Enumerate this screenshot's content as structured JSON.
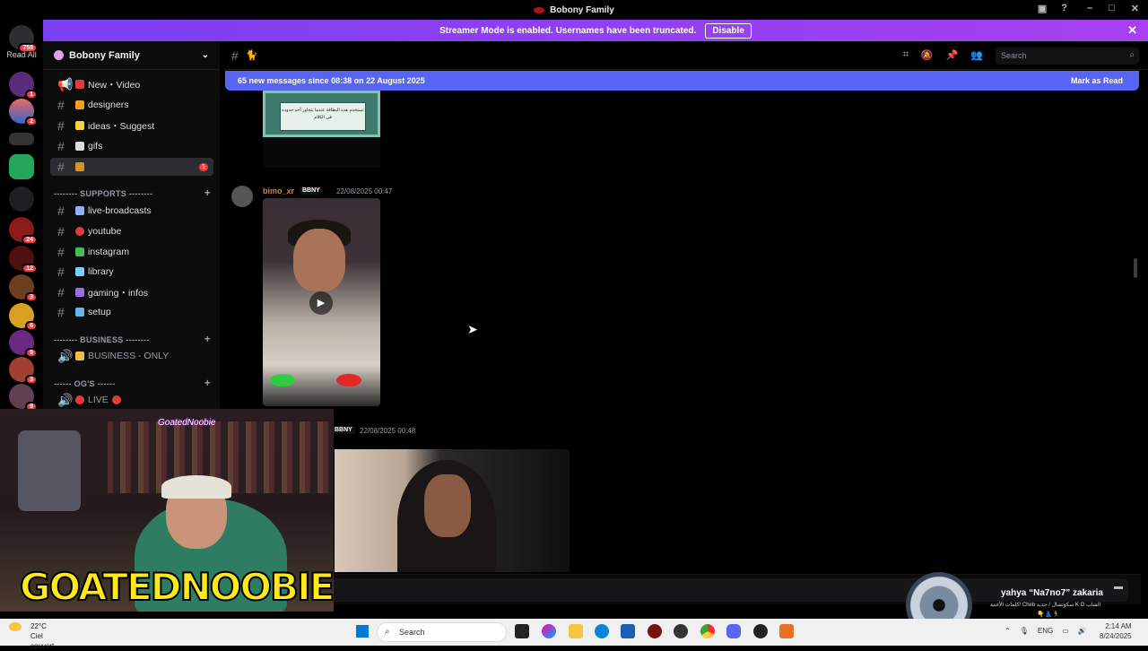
{
  "window": {
    "title": "Bobony Family"
  },
  "servers": {
    "read_all_label": "Read All",
    "top_badge": "758",
    "badges": [
      "1",
      "2",
      "24",
      "12",
      "3",
      "6",
      "9",
      "3",
      "9"
    ]
  },
  "streamer_banner": {
    "text": "Streamer Mode is enabled. Usernames have been truncated.",
    "disable_label": "Disable"
  },
  "guild": {
    "name": "Bobony Family"
  },
  "channels": [
    {
      "name": "New・Video",
      "prefix": "📢",
      "color": "#e23b3b"
    },
    {
      "name": "designers",
      "color": "#f0a020"
    },
    {
      "name": "ideas・Suggest",
      "color": "#f5d33a"
    },
    {
      "name": "gifs",
      "color": "#dddddd"
    },
    {
      "name": "",
      "color": "#d8922a",
      "selected": true,
      "unread": "1"
    }
  ],
  "categories": {
    "supports": "-------- SUPPORTS --------",
    "business": "-------- BUSINESS --------",
    "ogs": "------ OG'S ------"
  },
  "support_channels": [
    {
      "name": "live-broadcasts",
      "color": "#8fb0ff"
    },
    {
      "name": "youtube",
      "color": "#e23b3b"
    },
    {
      "name": "instagram",
      "color": "#3cbf55"
    },
    {
      "name": "library",
      "color": "#7ad0ff"
    },
    {
      "name": "gaming・infos",
      "color": "#9b6ae8"
    },
    {
      "name": "setup",
      "color": "#5fb8e8"
    }
  ],
  "business_channel": {
    "name": "BUSINESS - ONLY"
  },
  "og_channel": {
    "name": "LIVE"
  },
  "topbar": {
    "search_placeholder": "Search"
  },
  "new_messages": {
    "text": "65 new messages since 08:38 on 22 August 2025",
    "mark_read_label": "Mark as Read"
  },
  "messages": [
    {
      "user": "bimo_xr",
      "tag": "BBNY",
      "timestamp": "22/08/2025 00:47"
    },
    {
      "user": "",
      "tag": "BBNY",
      "timestamp": "22/08/2025 00:48"
    }
  ],
  "card_text": "تستخدم هذه البطاقة عندما يتجاوز أحد حدوده في الكلام",
  "webcam": {
    "handle": "GoatedNoobie",
    "brand": "GOATEDNOOBIE"
  },
  "notification": {
    "name": "yahya “Na7no7” zakaria",
    "subtitle": "كلمات الأغنية/ Cheb سكوتشال / جديد K O الشاب",
    "emoji": "👇👗🏃"
  },
  "taskbar": {
    "weather_temp": "22°C",
    "weather_desc": "Ciel couvert",
    "search_label": "Search",
    "language": "ENG",
    "time": "2:14 AM",
    "date": "8/24/2025"
  }
}
